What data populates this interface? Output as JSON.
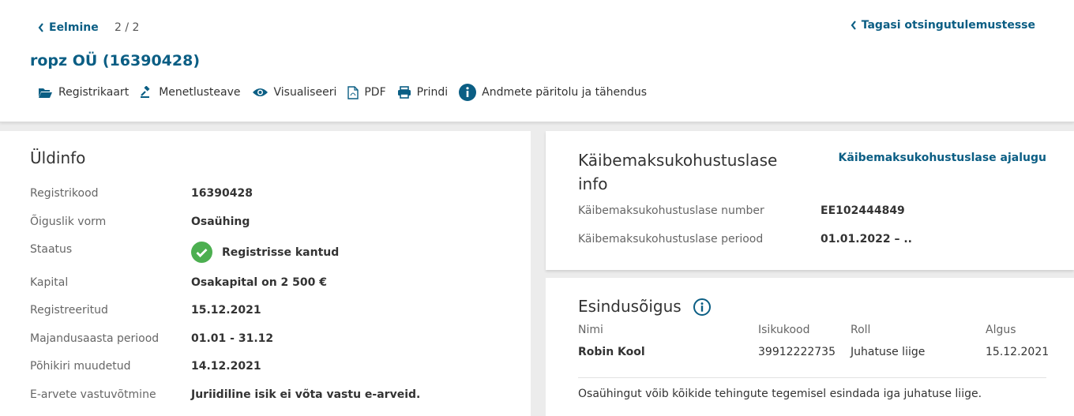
{
  "header": {
    "prev_label": "Eelmine",
    "pager": "2 / 2",
    "back_label": "Tagasi otsingutulemustesse",
    "company_title": "ropz OÜ (16390428)"
  },
  "toolbar": {
    "items": [
      {
        "label": "Registrikaart",
        "icon": "folder-open-icon"
      },
      {
        "label": "Menetlusteave",
        "icon": "gavel-icon"
      },
      {
        "label": "Visualiseeri",
        "icon": "eye-icon"
      },
      {
        "label": "PDF",
        "icon": "pdf-file-icon"
      },
      {
        "label": "Prindi",
        "icon": "printer-icon"
      },
      {
        "label": "Andmete päritolu ja tähendus",
        "icon": "info-icon"
      }
    ]
  },
  "general": {
    "title": "Üldinfo",
    "rows": [
      {
        "label": "Registrikood",
        "value": "16390428"
      },
      {
        "label": "Õiguslik vorm",
        "value": "Osaühing"
      },
      {
        "label": "Staatus",
        "value": "Registrisse kantud"
      },
      {
        "label": "Kapital",
        "value": "Osakapital on 2 500 €"
      },
      {
        "label": "Registreeritud",
        "value": "15.12.2021"
      },
      {
        "label": "Majandusaasta periood",
        "value": "01.01 - 31.12"
      },
      {
        "label": "Põhikiri muudetud",
        "value": "14.12.2021"
      },
      {
        "label": "E-arvete vastuvõtmine",
        "value": "Juriidiline isik ei võta vastu e-arveid."
      }
    ]
  },
  "vat": {
    "title_line1": "Käibemaksukohustuslase",
    "title_line2": "info",
    "history_link": "Käibemaksukohustuslase ajalugu",
    "rows": [
      {
        "label": "Käibemaksukohustuslase number",
        "value": "EE102444849"
      },
      {
        "label": "Käibemaksukohustuslase periood",
        "value": "01.01.2022 – .."
      }
    ]
  },
  "representation": {
    "title": "Esindusõigus",
    "columns": [
      "Nimi",
      "Isikukood",
      "Roll",
      "Algus"
    ],
    "rows": [
      {
        "name": "Robin Kool",
        "code": "39912222735",
        "role": "Juhatuse liige",
        "start": "15.12.2021"
      }
    ],
    "note": "Osaühingut võib kõikide tehingute tegemisel esindada iga juhatuse liige."
  },
  "colors": {
    "accent": "#0b5e84",
    "status_ok": "#4caf50"
  }
}
